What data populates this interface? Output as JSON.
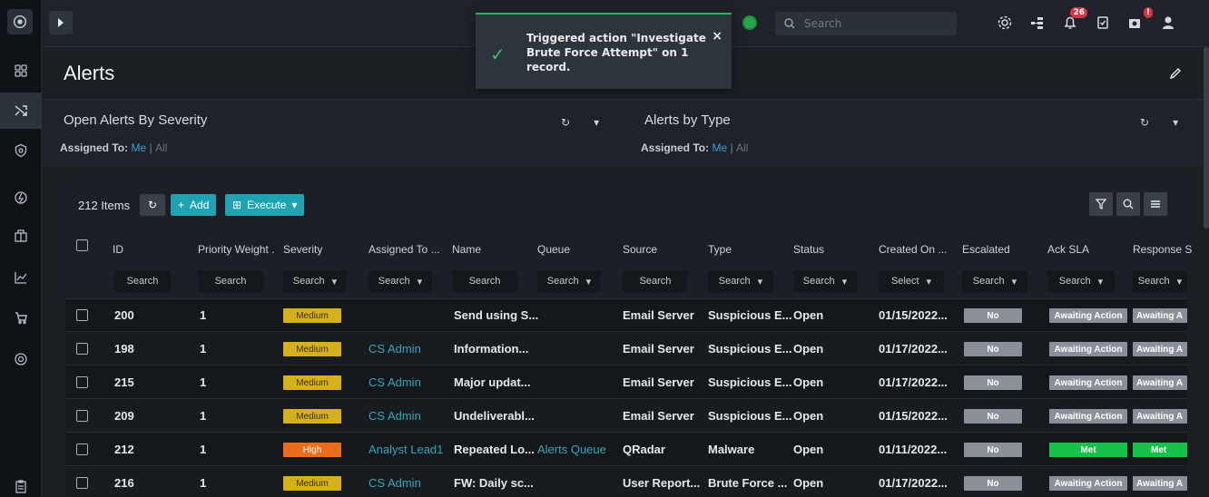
{
  "toast": {
    "message": "Triggered action \"Investigate Brute Force Attempt\" on 1 record.",
    "close": "×"
  },
  "topbar": {
    "search_placeholder": "Search",
    "notifications_count": "26",
    "workflow_alert": "!"
  },
  "page": {
    "title": "Alerts"
  },
  "widgets": [
    {
      "title": "Open Alerts By Severity",
      "assigned_label": "Assigned To:",
      "me": "Me",
      "sep": "|",
      "all": "All"
    },
    {
      "title": "Alerts by Type",
      "assigned_label": "Assigned To:",
      "me": "Me",
      "sep": "|",
      "all": "All"
    }
  ],
  "grid": {
    "count": "212 Items",
    "add_label": "Add",
    "execute_label": "Execute",
    "columns": [
      {
        "label": "ID",
        "filter": "Search"
      },
      {
        "label": "Priority Weight .",
        "filter": "Search"
      },
      {
        "label": "Severity",
        "filter": "Search"
      },
      {
        "label": "Assigned To ...",
        "filter": "Search"
      },
      {
        "label": "Name",
        "filter": "Search"
      },
      {
        "label": "Queue",
        "filter": "Search"
      },
      {
        "label": "Source",
        "filter": "Search"
      },
      {
        "label": "Type",
        "filter": "Search"
      },
      {
        "label": "Status",
        "filter": "Search"
      },
      {
        "label": "Created On ...",
        "filter": "Select"
      },
      {
        "label": "Escalated",
        "filter": "Search"
      },
      {
        "label": "Ack SLA",
        "filter": "Search"
      },
      {
        "label": "Response S",
        "filter": "Search"
      }
    ],
    "rows": [
      {
        "id": "200",
        "priority": "1",
        "severity": "Medium",
        "assigned": "",
        "name": "Send using S...",
        "queue": "",
        "source": "Email Server",
        "type": "Suspicious E...",
        "status": "Open",
        "created": "01/15/2022...",
        "escalated": "No",
        "ack": "Awaiting Action",
        "resp": "Awaiting A"
      },
      {
        "id": "198",
        "priority": "1",
        "severity": "Medium",
        "assigned": "CS Admin",
        "name": "Information...",
        "queue": "",
        "source": "Email Server",
        "type": "Suspicious E...",
        "status": "Open",
        "created": "01/17/2022...",
        "escalated": "No",
        "ack": "Awaiting Action",
        "resp": "Awaiting A"
      },
      {
        "id": "215",
        "priority": "1",
        "severity": "Medium",
        "assigned": "CS Admin",
        "name": "Major updat...",
        "queue": "",
        "source": "Email Server",
        "type": "Suspicious E...",
        "status": "Open",
        "created": "01/17/2022...",
        "escalated": "No",
        "ack": "Awaiting Action",
        "resp": "Awaiting A"
      },
      {
        "id": "209",
        "priority": "1",
        "severity": "Medium",
        "assigned": "CS Admin",
        "name": "Undeliverabl...",
        "queue": "",
        "source": "Email Server",
        "type": "Suspicious E...",
        "status": "Open",
        "created": "01/15/2022...",
        "escalated": "No",
        "ack": "Awaiting Action",
        "resp": "Awaiting A"
      },
      {
        "id": "212",
        "priority": "1",
        "severity": "High",
        "assigned": "Analyst Lead1",
        "name": "Repeated Lo...",
        "queue": "Alerts Queue",
        "source": "QRadar",
        "type": "Malware",
        "status": "Open",
        "created": "01/11/2022...",
        "escalated": "No",
        "ack": "Met",
        "resp": "Met"
      },
      {
        "id": "216",
        "priority": "1",
        "severity": "Medium",
        "assigned": "CS Admin",
        "name": "FW: Daily sc...",
        "queue": "",
        "source": "User Report...",
        "type": "Brute Force ...",
        "status": "Open",
        "created": "01/17/2022...",
        "escalated": "No",
        "ack": "Awaiting Action",
        "resp": "Awaiting A"
      }
    ]
  },
  "colors": {
    "accent": "#1fa3b3",
    "link": "#35a7b8",
    "medium": "#d6b01a",
    "high": "#e86e1c",
    "met": "#17c24a"
  }
}
